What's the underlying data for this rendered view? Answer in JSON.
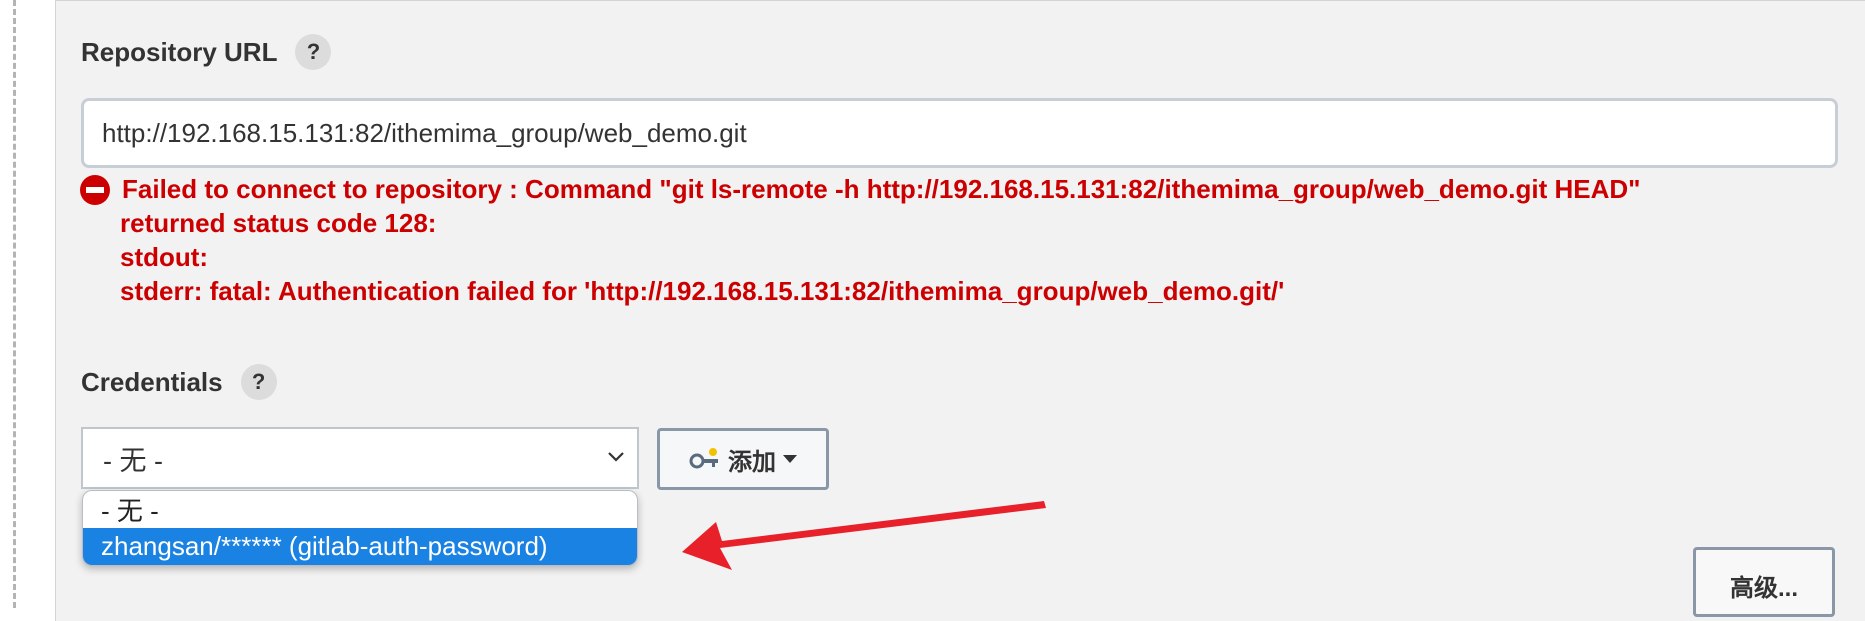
{
  "repository": {
    "label": "Repository URL",
    "help": "?",
    "url_value": "http://192.168.15.131:82/ithemima_group/web_demo.git",
    "error_lines": [
      "Failed to connect to repository : Command \"git ls-remote -h http://192.168.15.131:82/ithemima_group/web_demo.git HEAD\"",
      "returned status code 128:",
      "stdout:",
      "stderr: fatal: Authentication failed for 'http://192.168.15.131:82/ithemima_group/web_demo.git/'"
    ]
  },
  "credentials": {
    "label": "Credentials",
    "help": "?",
    "selected": "- 无 -",
    "add_button": "添加",
    "options": [
      "- 无 -",
      "zhangsan/****** (gitlab-auth-password)"
    ],
    "highlighted_option_index": 1
  },
  "advanced_button": "高级...",
  "colors": {
    "error": "#cc0000",
    "highlight": "#1a82e2",
    "arrow": "#e8202a"
  },
  "icons": {
    "error": "stop-icon",
    "add": "key-icon",
    "select": "chevron-down-icon",
    "add_dropdown": "caret-down-icon",
    "annotation": "arrow-annotation"
  }
}
